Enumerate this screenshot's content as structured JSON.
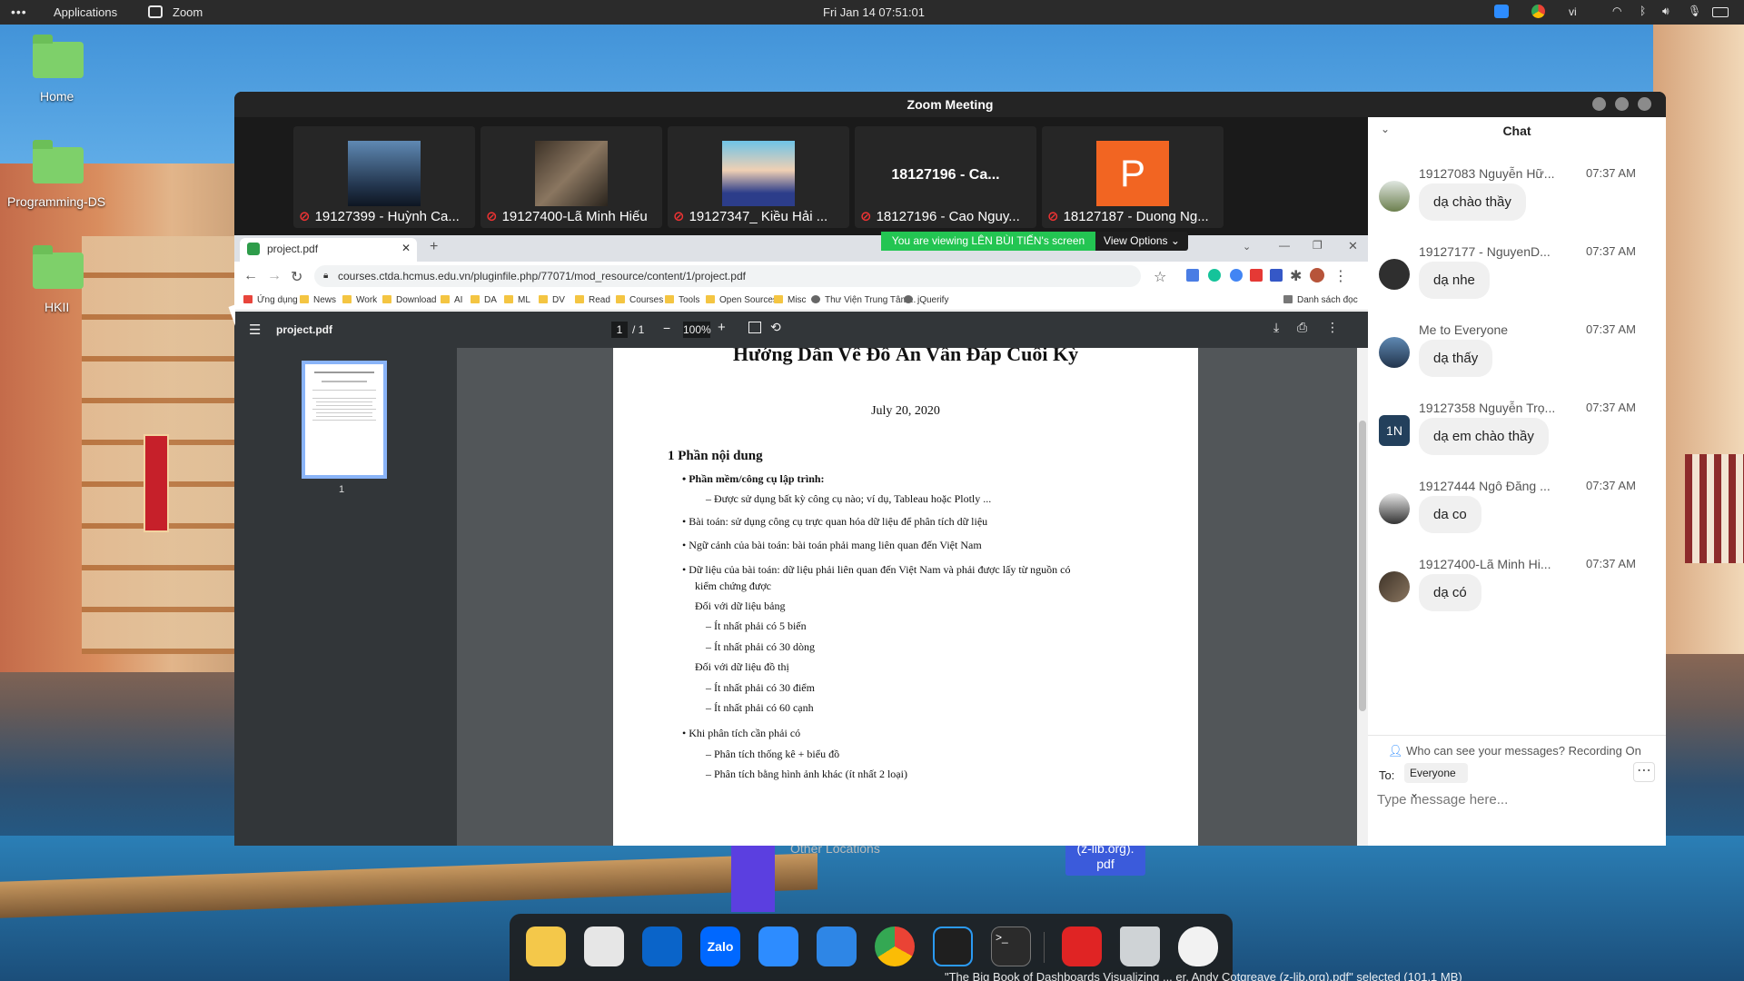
{
  "topbar": {
    "apps_label": "Applications",
    "zoom_label": "Zoom",
    "clock": "Fri Jan 14  07:51:01",
    "lang": "vi"
  },
  "desktop": {
    "icons": [
      "Home",
      "Programming-DS",
      "HKII"
    ]
  },
  "zoom": {
    "title": "Zoom Meeting",
    "participants": [
      {
        "name": "19127399 - Huỳnh Ca..."
      },
      {
        "name": "19127400-Lã Minh Hiếu"
      },
      {
        "name": "19127347_ Kiều Hải ..."
      },
      {
        "name": "18127196 - Cao Nguy...",
        "center_text": "18127196 - Ca..."
      },
      {
        "name": "18127187 - Duong Ng...",
        "avatar_letter": "P"
      }
    ],
    "share_banner": "You are viewing LÊN BÙI TIẾN's screen",
    "view_options": "View Options"
  },
  "browser": {
    "tab_title": "project.pdf",
    "url": "courses.ctda.hcmus.edu.vn/pluginfile.php/77071/mod_resource/content/1/project.pdf",
    "bookmarks": [
      "Ứng dụng",
      "News",
      "Work",
      "Download",
      "AI",
      "DA",
      "ML",
      "DV",
      "Read",
      "Courses",
      "Tools",
      "Open Sources",
      "Misc",
      "Thư Viện Trung Tâm...",
      "jQuerify"
    ],
    "reading_list": "Danh sách đọc"
  },
  "pdf": {
    "file_name": "project.pdf",
    "page_current": "1",
    "page_total": "/   1",
    "zoom": "100%",
    "thumb_label": "1",
    "title": "Hướng Dẫn Về Đồ Án Vấn Đáp Cuối Kỳ",
    "date": "July 20, 2020",
    "section": "1  Phần nội dung",
    "lines": [
      {
        "text": "•  Phần mềm/công cụ lập trình:",
        "bold_part": true
      },
      {
        "text": "–  Được sử dụng bất kỳ công cụ nào; ví dụ, Tableau hoặc Plotly ..."
      },
      {
        "text": "•  Bài toán: sử dụng công cụ trực quan hóa dữ liệu để phân tích dữ liệu"
      },
      {
        "text": "•  Ngữ cảnh của bài toán: bài toán phải mang liên quan đến Việt Nam"
      },
      {
        "text": "•  Dữ liệu của bài toán: dữ liệu phải liên quan đến Việt Nam và phải được lấy từ nguồn có"
      },
      {
        "text": "kiểm chứng được"
      },
      {
        "text": "Đối với dữ liệu bảng"
      },
      {
        "text": "–  Ít nhất phải có 5 biến"
      },
      {
        "text": "–  Ít nhất phải có 30 dòng"
      },
      {
        "text": "Đối với dữ liệu đồ thị"
      },
      {
        "text": "–  Ít nhất phải có 30 điểm"
      },
      {
        "text": "–  Ít nhất phải có 60 cạnh"
      },
      {
        "text": "•  Khi phân tích cần phải có"
      },
      {
        "text": "–  Phân tích thống kê + biểu đồ"
      },
      {
        "text": "–  Phân tích bằng hình ảnh khác (ít nhất 2 loại)"
      }
    ]
  },
  "chat": {
    "header": "Chat",
    "messages": [
      {
        "sender": "19127083 Nguyễn Hữ...",
        "time": "07:37 AM",
        "text": "dạ chào thầy"
      },
      {
        "sender": "19127177 - NguyenD...",
        "time": "07:37 AM",
        "text": "dạ nhe"
      },
      {
        "sender": "Me to Everyone",
        "time": "07:37 AM",
        "text": "dạ thấy"
      },
      {
        "sender": "19127358 Nguyễn Trọ...",
        "time": "07:37 AM",
        "text": "dạ em chào thầy",
        "initials": "1N"
      },
      {
        "sender": "19127444 Ngô Đăng ...",
        "time": "07:37 AM",
        "text": "da co"
      },
      {
        "sender": "19127400-Lã Minh Hi...",
        "time": "07:37 AM",
        "text": "dạ có"
      }
    ],
    "visibility_note": "Who can see your messages? Recording On",
    "to_label": "To:",
    "to_value": "Everyone",
    "input_placeholder": "Type message here..."
  },
  "behind": {
    "other_locations": "Other Locations",
    "file_chip_line1": "(z-lib.org).",
    "file_chip_line2": "pdf",
    "status_text": "\"The Big Book of Dashboards Visualizing ... er, Andy Cotgreave (z-lib.org).pdf\" selected (101.1 MB)"
  },
  "colors": {
    "share_green": "#23c552",
    "zoom_blue": "#2d8cff",
    "chat_bubble": "#f0f0f0"
  }
}
